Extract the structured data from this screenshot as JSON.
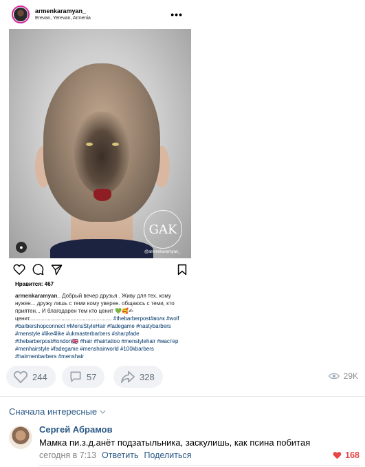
{
  "instagram": {
    "username": "armenkaramyan_",
    "location": "Erevan, Yerevan, Armenia",
    "more": "•••",
    "watermark_monogram": "GAK",
    "watermark_handle": "@armenkaramyan_",
    "likes": "Нравится: 467",
    "caption_user": "armenkaramyan_",
    "caption_text": "Добрый вечер друзья . Живу для тех, кому нужен... дружу лишь с теми кому уверен. общаюсь с теми, кто приятен... И благодарен тем кто ценит 💚🥰✍ ценит......................................................",
    "hashtags": "#thebarberpost#волк #wolf #barbershopconnect #MensStyleHair #fadegame #nastybarbers #menstyle #like4like #ukmasterbarbers #sharpfade #thebarberpost#london🇬🇧 #hair #hairtattoo #menstylehair #мастер #menhairstyle #fadegame #menshairworld #100kbarbers #hairmenbarbers #menshair"
  },
  "vk": {
    "likes": "244",
    "comments": "57",
    "shares": "328",
    "views": "29K",
    "sort_label": "Сначала интересные",
    "comment": {
      "author": "Сергей Абрамов",
      "text": "Мамка пи.з.д.анёт подзатыльника, заскулишь, как псина побитая",
      "time": "сегодня в 7:13",
      "reply": "Ответить",
      "share": "Поделиться",
      "likes": "168"
    }
  },
  "colors": {
    "vk_link": "#2a5885",
    "vk_like_red": "#e64646",
    "pill_bg": "#f0f2f5"
  }
}
